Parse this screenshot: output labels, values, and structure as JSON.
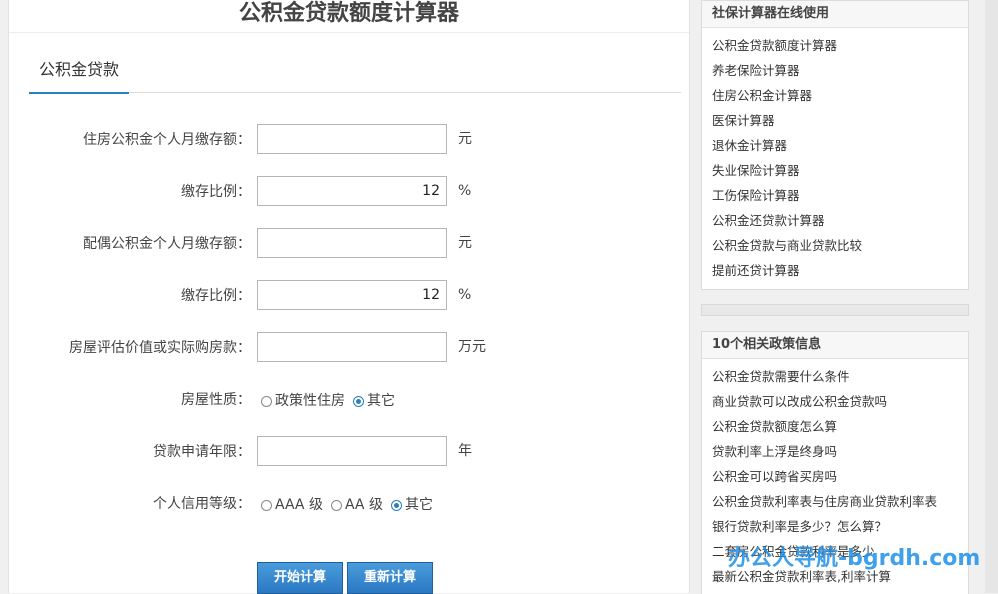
{
  "page": {
    "title": "公积金贷款额度计算器"
  },
  "tab": {
    "label": "公积金贷款"
  },
  "form": {
    "personal_deposit": {
      "label": "住房公积金个人月缴存额：",
      "value": "",
      "unit": "元"
    },
    "personal_ratio": {
      "label": "缴存比例：",
      "value": "12",
      "unit": "%"
    },
    "spouse_deposit": {
      "label": "配偶公积金个人月缴存额：",
      "value": "",
      "unit": "元"
    },
    "spouse_ratio": {
      "label": "缴存比例：",
      "value": "12",
      "unit": "%"
    },
    "house_value": {
      "label": "房屋评估价值或实际购房款：",
      "value": "",
      "unit": "万元"
    },
    "house_type": {
      "label": "房屋性质：",
      "options": [
        "政策性住房",
        "其它"
      ],
      "selected": "其它"
    },
    "loan_years": {
      "label": "贷款申请年限：",
      "value": "",
      "unit": "年"
    },
    "credit": {
      "label": "个人信用等级：",
      "options": [
        "AAA 级",
        "AA 级",
        "其它"
      ],
      "selected": "其它"
    }
  },
  "buttons": {
    "calc": "开始计算",
    "reset": "重新计算"
  },
  "sidebar": {
    "tools": {
      "title": "社保计算器在线使用",
      "items": [
        "公积金贷款额度计算器",
        "养老保险计算器",
        "住房公积金计算器",
        "医保计算器",
        "退休金计算器",
        "失业保险计算器",
        "工伤保险计算器",
        "公积金还贷款计算器",
        "公积金贷款与商业贷款比较",
        "提前还贷计算器"
      ]
    },
    "policy": {
      "title": "10个相关政策信息",
      "items": [
        "公积金贷款需要什么条件",
        "商业贷款可以改成公积金贷款吗",
        "公积金贷款额度怎么算",
        "贷款利率上浮是终身吗",
        "公积金可以跨省买房吗",
        "公积金贷款利率表与住房商业贷款利率表",
        "银行贷款利率是多少？怎么算？",
        "二套房公积金贷款利率是多少",
        "最新公积金贷款利率表,利率计算"
      ]
    }
  },
  "watermark": "办公人导航-bgrdh.com"
}
